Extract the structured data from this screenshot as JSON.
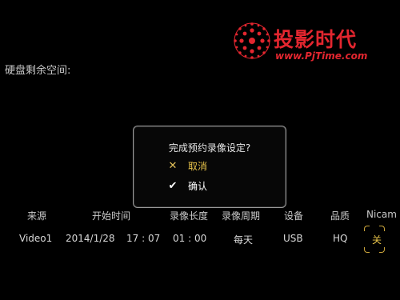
{
  "watermark": {
    "brand_cn": "投影时代",
    "brand_url": "www.PjTime.com"
  },
  "disk": {
    "label": "硬盘剩余空间:"
  },
  "dialog": {
    "title": "完成预约录像设定?",
    "options": [
      {
        "icon": "close-icon",
        "label": "取消",
        "selected": true,
        "color": "#e9c44a"
      },
      {
        "icon": "check-icon",
        "label": "确认",
        "selected": false,
        "color": "#ffffff"
      }
    ]
  },
  "table": {
    "headers": [
      "来源",
      "开始时间",
      "录像长度",
      "录像周期",
      "设备",
      "品质",
      "Nicam"
    ],
    "row": {
      "source": "Video1",
      "date": "2014/1/28",
      "start_time": "17 : 07",
      "duration": "01 : 00",
      "period": "每天",
      "device": "USB",
      "quality": "HQ",
      "nicam": "关"
    }
  },
  "colors": {
    "background": "#000000",
    "accent": "#e9c44a",
    "brand": "#e3262f"
  }
}
